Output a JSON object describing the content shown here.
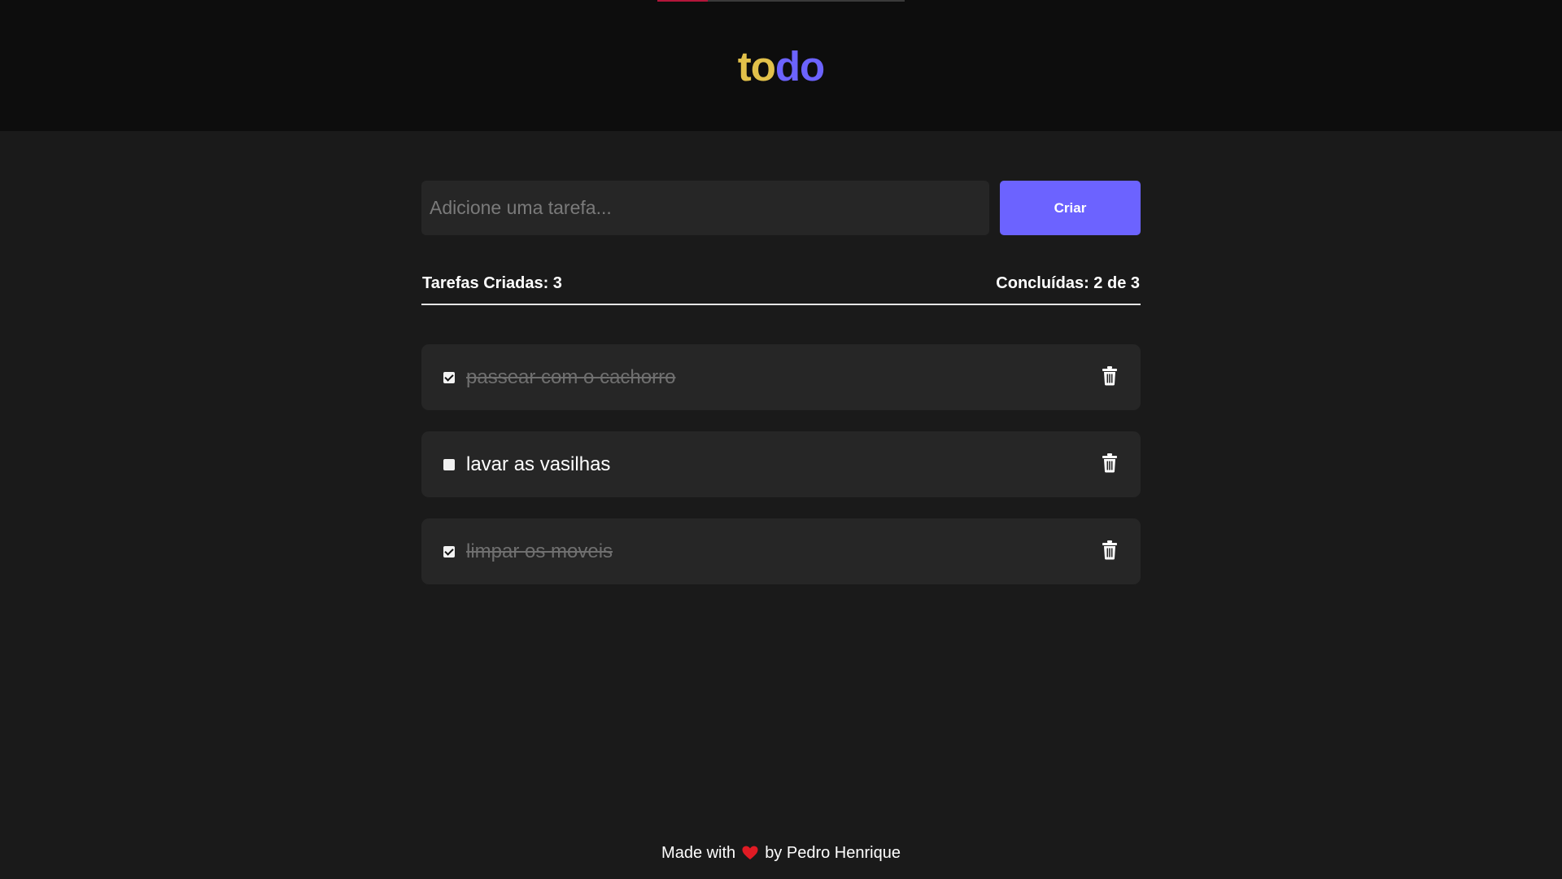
{
  "header": {
    "logo_part_a": "to",
    "logo_part_b": "do"
  },
  "form": {
    "placeholder": "Adicione uma tarefa...",
    "value": "",
    "create_label": "Criar"
  },
  "stats": {
    "created_label": "Tarefas Criadas: 3",
    "completed_label": "Concluídas: 2 de 3"
  },
  "tasks": [
    {
      "text": "passear com o cachorro",
      "done": true
    },
    {
      "text": "lavar as vasilhas",
      "done": false
    },
    {
      "text": "limpar os moveis",
      "done": true
    }
  ],
  "footer": {
    "made_with": "Made with",
    "by": "by Pedro Henrique"
  },
  "colors": {
    "accent": "#6c63ff",
    "logo_yellow": "#e2c14a",
    "heart": "#e01b24"
  },
  "icons": {
    "delete": "trash-icon",
    "heart": "heart-icon",
    "checkbox": "checkbox-icon"
  }
}
